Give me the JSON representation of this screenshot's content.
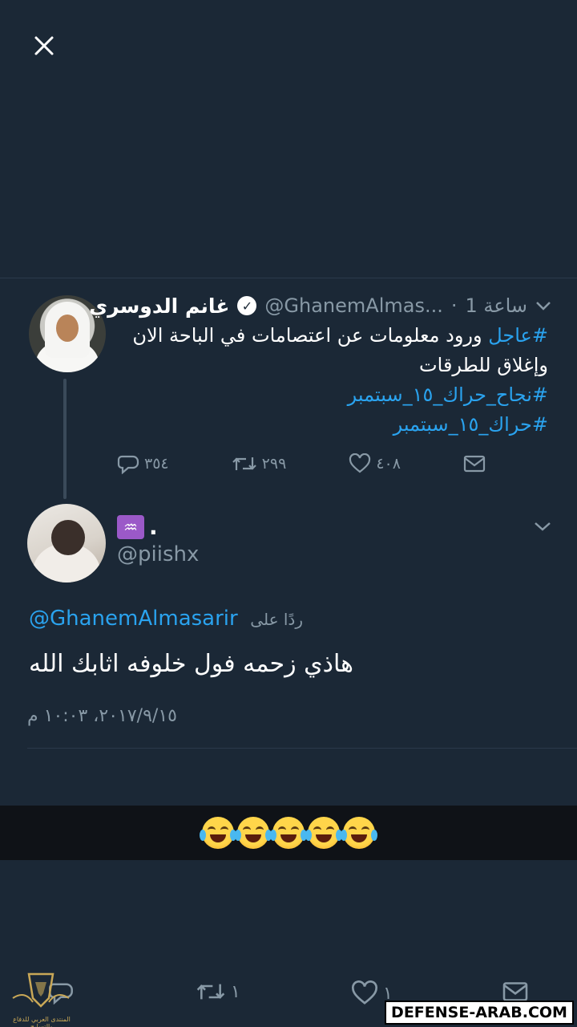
{
  "tweet": {
    "display_name": "غانم الدوسري",
    "handle": "@GhanemAlmas...",
    "timestamp": "1 ساعة",
    "text_line1_hashtag": "#عاجل",
    "text_line1_rest": " ورود معلومات عن اعتصامات في الباحة  الان",
    "text_line2": "وإغلاق للطرقات",
    "hashtag2": "#نجاح_حراك_١٥_سبتمبر",
    "hashtag3": "#حراك_١٥_سبتمبر",
    "replies": "٣٥٤",
    "retweets": "٢٩٩",
    "likes": "٤٠٨"
  },
  "reply": {
    "name_emoji": "♒",
    "name": ".",
    "handle": "@piishx",
    "replying_to_label": "ردًا على",
    "replying_to_handle": "@GhanemAlmasarir",
    "text": "هاذي زحمه فول خلوفه اثابك الله",
    "timestamp": "٢٠١٧/٩/١٥، ١٠:٠٣ م"
  },
  "bottom_bar": {
    "retweet_count": "١",
    "like_count": "١"
  },
  "watermark": "DEFENSE-ARAB.COM",
  "logo_text": "المنتدى العربي للدفاع والتسليح",
  "colors": {
    "background": "#1b2836",
    "accent": "#2aa3ef",
    "muted": "#8899a6"
  }
}
